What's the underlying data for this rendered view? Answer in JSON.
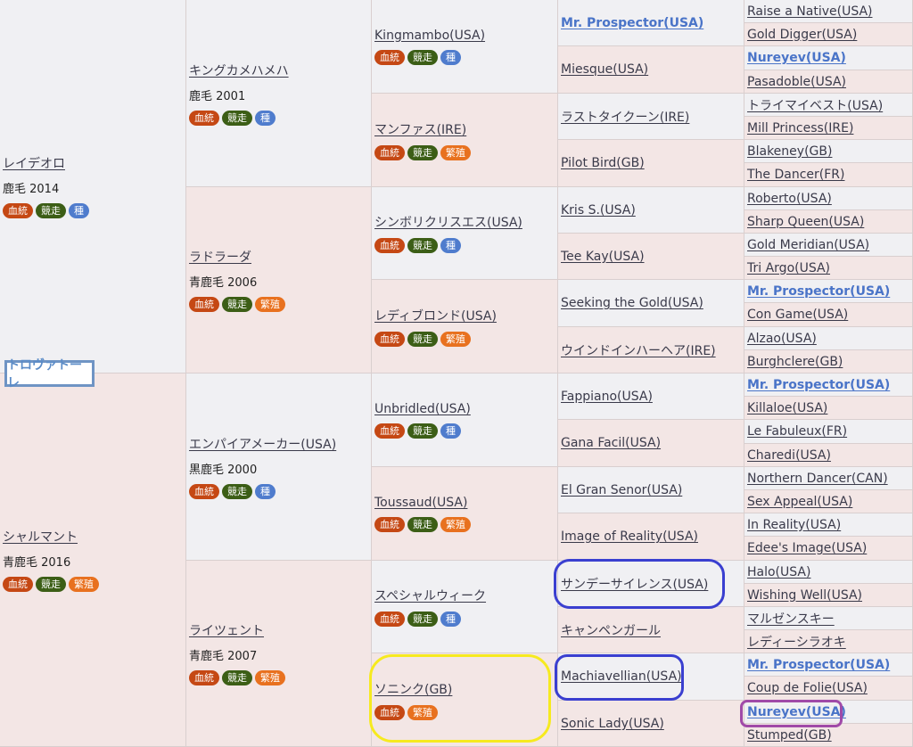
{
  "subject": "トロヴァトーレ",
  "badges": {
    "blood": "血統",
    "race": "競走",
    "stud": "種",
    "breed": "繁殖"
  },
  "gen1": [
    {
      "name": "レイデオロ",
      "info": "鹿毛 2014",
      "badges": [
        "blood",
        "race",
        "stud"
      ]
    },
    {
      "name": "シャルマント",
      "info": "青鹿毛 2016",
      "badges": [
        "blood",
        "race",
        "breed"
      ]
    }
  ],
  "gen2": [
    {
      "name": "キングカメハメハ",
      "info": "鹿毛 2001",
      "badges": [
        "blood",
        "race",
        "stud"
      ]
    },
    {
      "name": "ラドラーダ",
      "info": "青鹿毛 2006",
      "badges": [
        "blood",
        "race",
        "breed"
      ]
    },
    {
      "name": "エンパイアメーカー(USA)",
      "info": "黒鹿毛 2000",
      "badges": [
        "blood",
        "race",
        "stud"
      ]
    },
    {
      "name": "ライツェント",
      "info": "青鹿毛 2007",
      "badges": [
        "blood",
        "race",
        "breed"
      ]
    }
  ],
  "gen3": [
    {
      "name": "Kingmambo(USA)",
      "badges": [
        "blood",
        "race",
        "stud"
      ]
    },
    {
      "name": "マンファス(IRE)",
      "badges": [
        "blood",
        "race",
        "breed"
      ]
    },
    {
      "name": "シンボリクリスエス(USA)",
      "badges": [
        "blood",
        "race",
        "stud"
      ]
    },
    {
      "name": "レディブロンド(USA)",
      "badges": [
        "blood",
        "race",
        "breed"
      ]
    },
    {
      "name": "Unbridled(USA)",
      "badges": [
        "blood",
        "race",
        "stud"
      ]
    },
    {
      "name": "Toussaud(USA)",
      "badges": [
        "blood",
        "race",
        "breed"
      ]
    },
    {
      "name": "スペシャルウィーク",
      "badges": [
        "blood",
        "race",
        "stud"
      ]
    },
    {
      "name": "ソニンク(GB)",
      "badges": [
        "blood",
        "breed"
      ]
    }
  ],
  "gen4": [
    {
      "name": "Mr. Prospector(USA)",
      "hl": true
    },
    {
      "name": "Miesque(USA)"
    },
    {
      "name": "ラストタイクーン(IRE)"
    },
    {
      "name": "Pilot Bird(GB)"
    },
    {
      "name": "Kris S.(USA)"
    },
    {
      "name": "Tee Kay(USA)"
    },
    {
      "name": "Seeking the Gold(USA)"
    },
    {
      "name": "ウインドインハーヘア(IRE)"
    },
    {
      "name": "Fappiano(USA)"
    },
    {
      "name": "Gana Facil(USA)"
    },
    {
      "name": "El Gran Senor(USA)"
    },
    {
      "name": "Image of Reality(USA)"
    },
    {
      "name": "サンデーサイレンス(USA)"
    },
    {
      "name": "キャンペンガール"
    },
    {
      "name": "Machiavellian(USA)"
    },
    {
      "name": "Sonic Lady(USA)"
    }
  ],
  "gen5": [
    {
      "name": "Raise a Native(USA)"
    },
    {
      "name": "Gold Digger(USA)"
    },
    {
      "name": "Nureyev(USA)",
      "hl": true
    },
    {
      "name": "Pasadoble(USA)"
    },
    {
      "name": "トライマイベスト(USA)"
    },
    {
      "name": "Mill Princess(IRE)"
    },
    {
      "name": "Blakeney(GB)"
    },
    {
      "name": "The Dancer(FR)"
    },
    {
      "name": "Roberto(USA)"
    },
    {
      "name": "Sharp Queen(USA)"
    },
    {
      "name": "Gold Meridian(USA)"
    },
    {
      "name": "Tri Argo(USA)"
    },
    {
      "name": "Mr. Prospector(USA)",
      "hl": true
    },
    {
      "name": "Con Game(USA)"
    },
    {
      "name": "Alzao(USA)"
    },
    {
      "name": "Burghclere(GB)"
    },
    {
      "name": "Mr. Prospector(USA)",
      "hl": true
    },
    {
      "name": "Killaloe(USA)"
    },
    {
      "name": "Le Fabuleux(FR)"
    },
    {
      "name": "Charedi(USA)"
    },
    {
      "name": "Northern Dancer(CAN)"
    },
    {
      "name": "Sex Appeal(USA)"
    },
    {
      "name": "In Reality(USA)"
    },
    {
      "name": "Edee's Image(USA)"
    },
    {
      "name": "Halo(USA)"
    },
    {
      "name": "Wishing Well(USA)"
    },
    {
      "name": "マルゼンスキー"
    },
    {
      "name": "レディーシラオキ"
    },
    {
      "name": "Mr. Prospector(USA)",
      "hl": true
    },
    {
      "name": "Coup de Folie(USA)"
    },
    {
      "name": "Nureyev(USA)",
      "hl": true
    },
    {
      "name": "Stumped(GB)"
    }
  ],
  "colors": {
    "ring_blue": "#3a3fd0",
    "ring_yellow": "#f6ea1f",
    "ring_purple": "#a04aa8"
  }
}
